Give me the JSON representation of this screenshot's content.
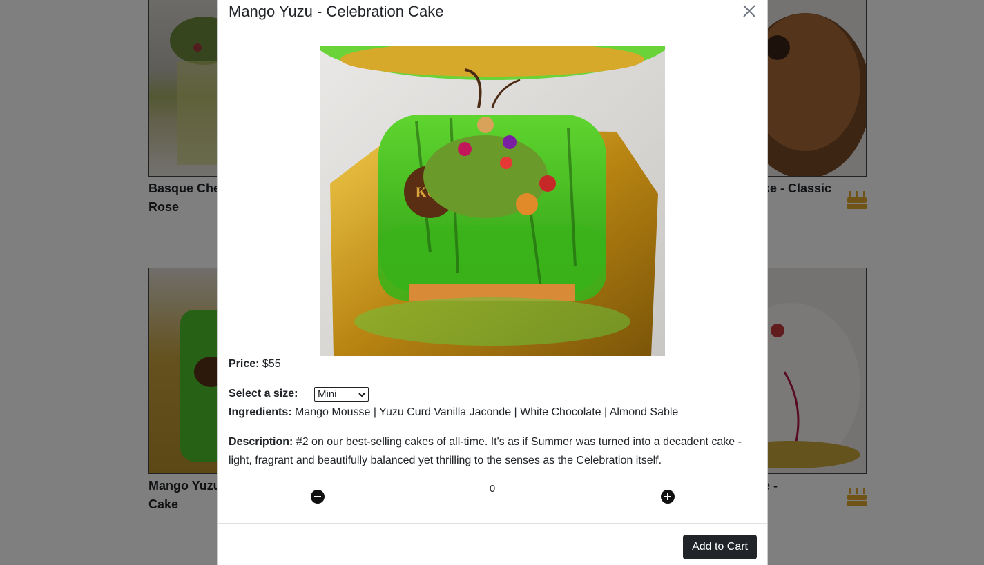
{
  "background_grid": {
    "cards": [
      {
        "title": "Basque Che",
        "title_line2": "Rose"
      },
      {
        "title": "ke - Classic",
        "title_line2": ""
      },
      {
        "title": "Mango Yuzu",
        "title_line2": "Cake"
      },
      {
        "title": "e -",
        "title_line2": ""
      }
    ],
    "cake_icon": "birthday-cake-icon",
    "accent_color": "#e0a82e"
  },
  "modal": {
    "title": "Mango Yuzu - Celebration Cake",
    "close_icon": "close-icon",
    "image_alt": "Mango Yuzu Celebration Cake",
    "price_label": "Price:",
    "price_value": "$55",
    "size_label": "Select a size:",
    "size_selected": "Mini",
    "ingredients_label": "Ingredients:",
    "ingredients_value": "Mango Mousse | Yuzu Curd Vanilla Jaconde | White Chocolate | Almond Sable",
    "description_label": "Description:",
    "description_value": "#2 on our best-selling cakes of all-time. It's as if Summer was turned into a decadent cake - light, fragrant and beautifully balanced yet thrilling to the senses as the Celebration itself.",
    "quantity": "0",
    "add_to_cart_label": "Add to Cart"
  }
}
